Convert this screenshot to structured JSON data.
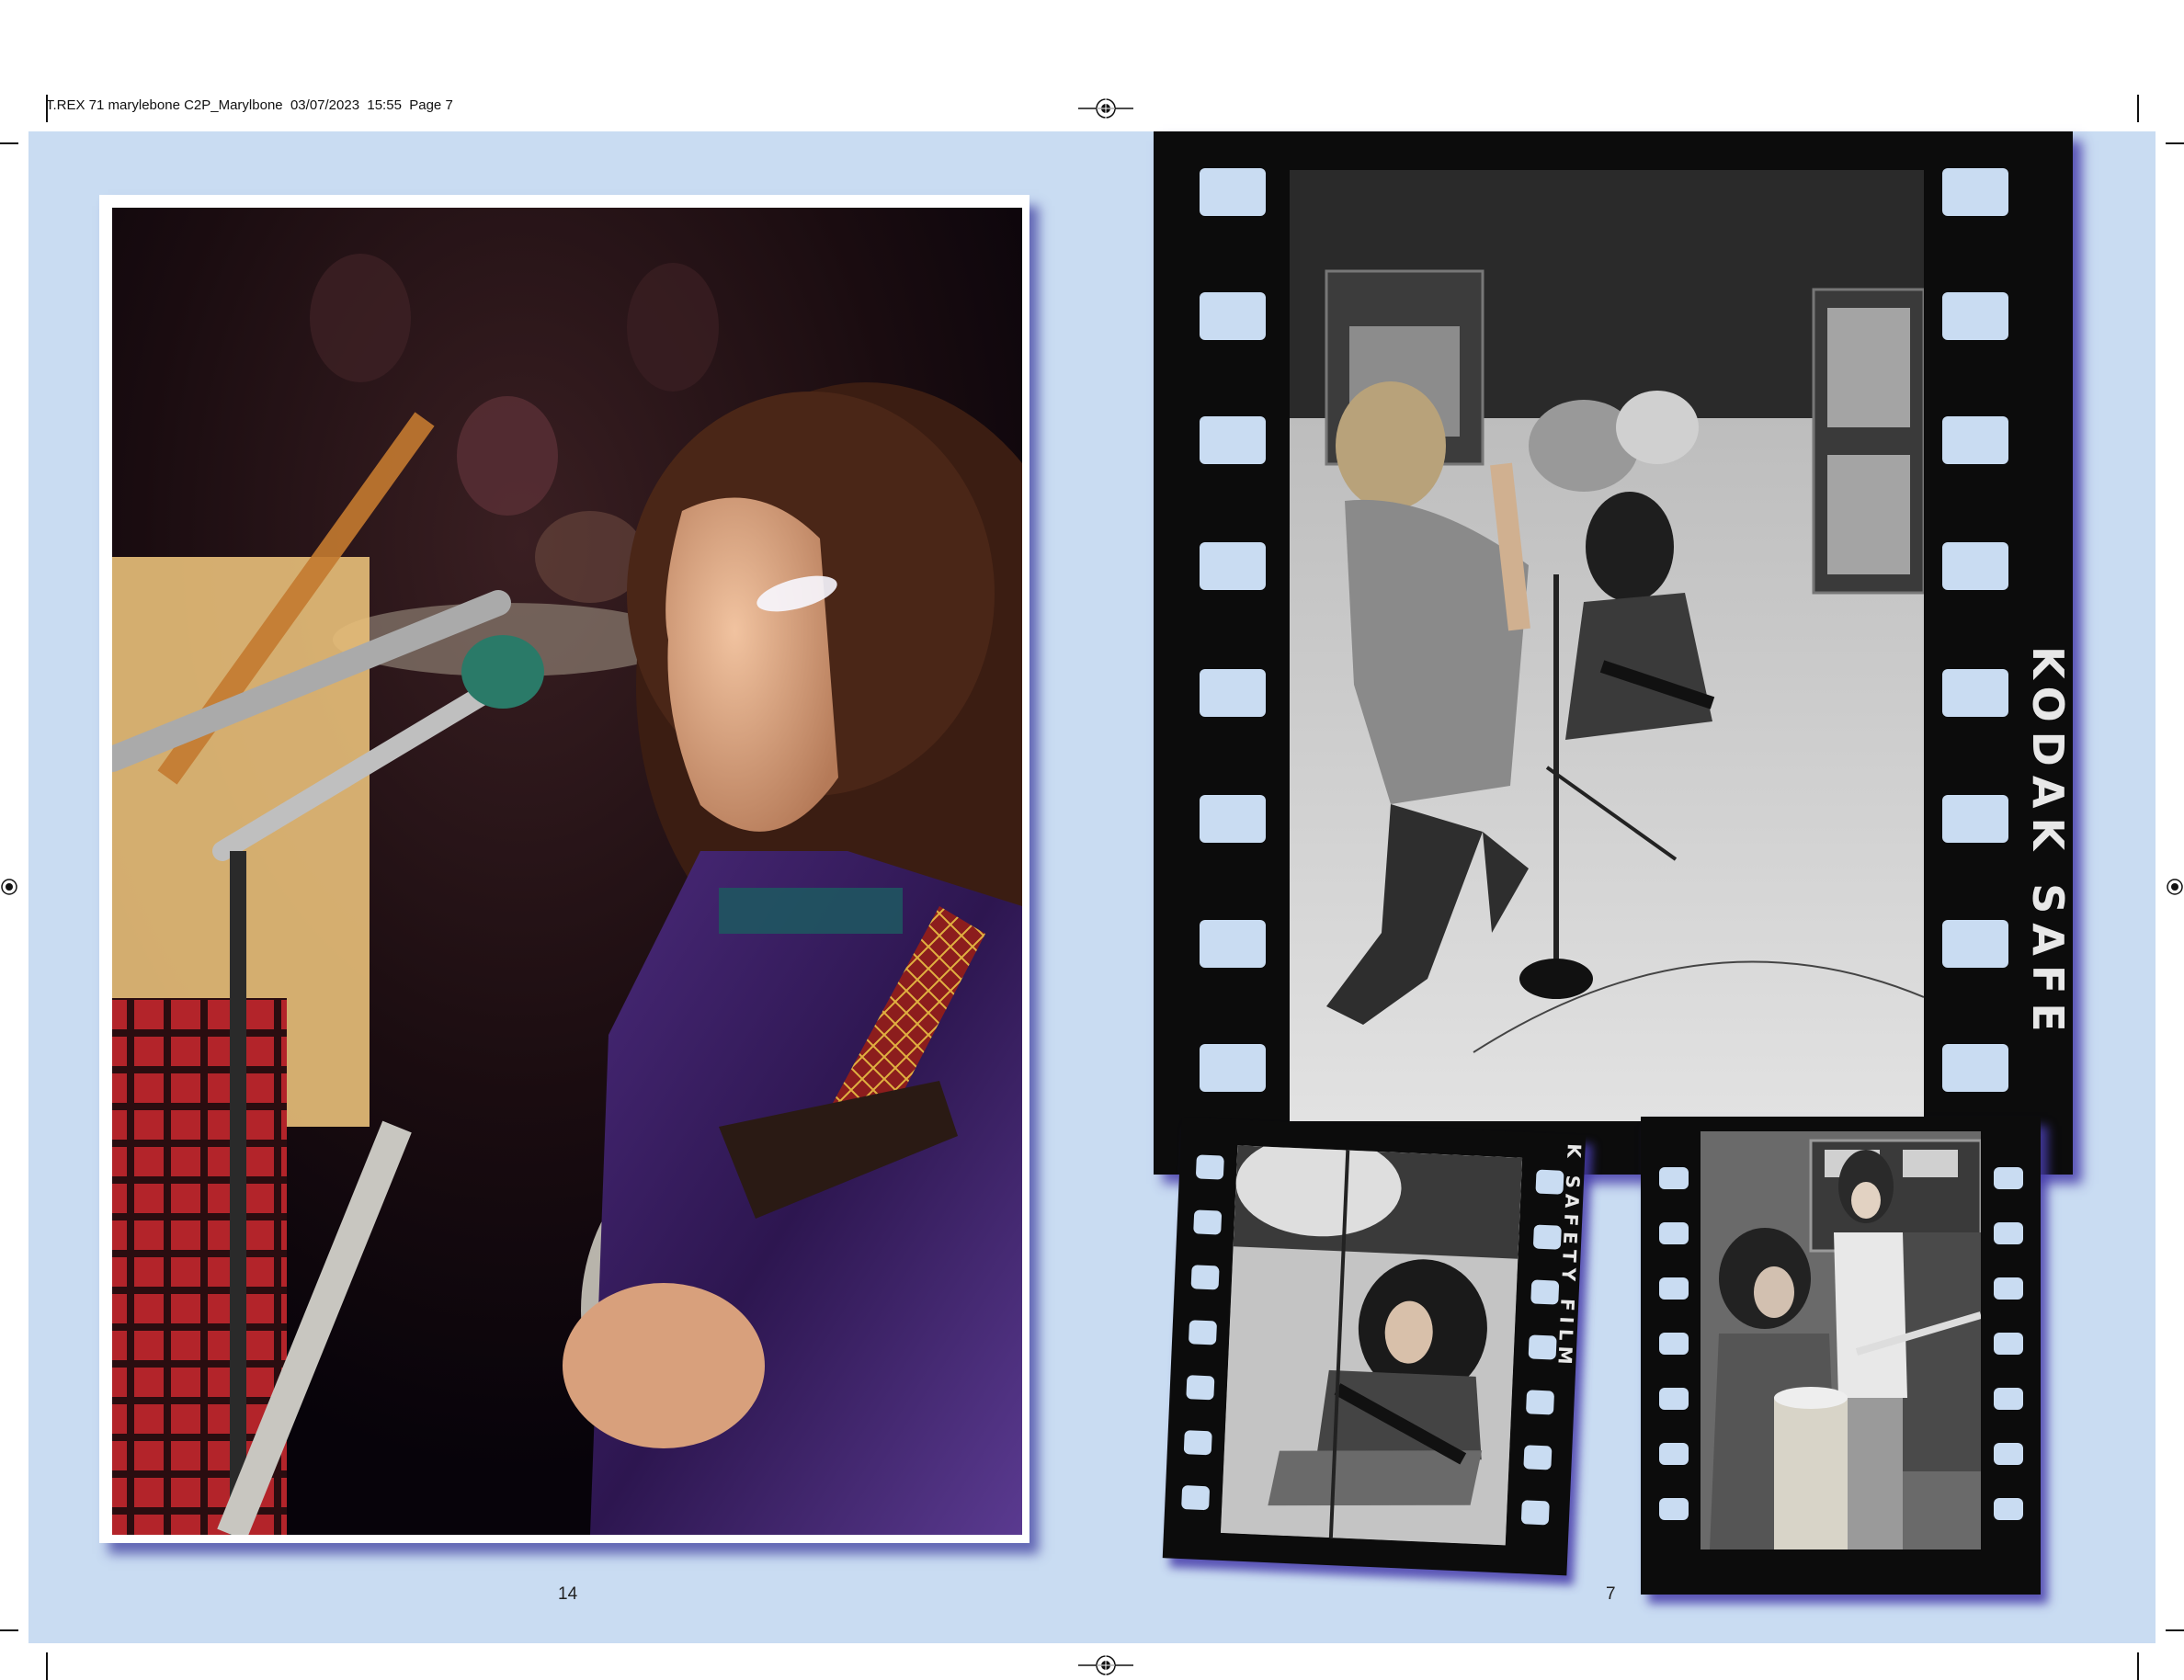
{
  "slug_line": "T.REX 71 marylebone C2P_Marylbone  03/07/2023  15:55  Page 7",
  "left_page": {
    "page_number": "14",
    "photo_description_icon": "concert-photo"
  },
  "right_page": {
    "page_number": "7",
    "film_edge_text_main": "KODAK SAFE",
    "film_edge_text_small": "K SAFETY FILM"
  },
  "colors": {
    "spread_background": "#c9dcf2",
    "frame_shadow": "#4040a0",
    "film_black": "#0c0c0c"
  }
}
